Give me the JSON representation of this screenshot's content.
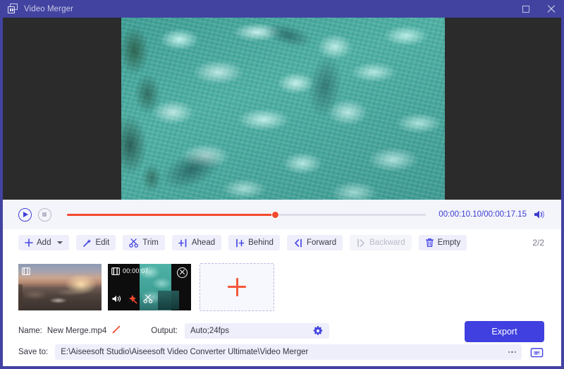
{
  "window": {
    "title": "Video Merger",
    "app_icon": "windows-stack-icon",
    "titlebar_color": "#4243a0",
    "controls": [
      {
        "name": "maximize-button",
        "icon": "maximize-icon"
      },
      {
        "name": "close-button",
        "icon": "close-icon"
      }
    ]
  },
  "preview": {
    "label": "video-preview",
    "letterbox_color": "#2b2b2b",
    "content_description": "turquoise water with caustic light patterns"
  },
  "player": {
    "play_icon": "play-icon",
    "stop_icon": "stop-icon",
    "progress_percent": 58,
    "progress_color": "#f4492d",
    "time_current": "00:00:10.10",
    "time_total": "00:00:17.15",
    "time_display": "00:00:10.10/00:00:17.15",
    "time_color": "#3b3bd0",
    "volume_icon": "volume-icon"
  },
  "toolbar": {
    "buttons": [
      {
        "label": "Add",
        "icon": "plus-icon",
        "has_dropdown": true,
        "disabled": false
      },
      {
        "label": "Edit",
        "icon": "magic-wand-icon",
        "has_dropdown": false,
        "disabled": false
      },
      {
        "label": "Trim",
        "icon": "scissors-icon",
        "has_dropdown": false,
        "disabled": false
      },
      {
        "label": "Ahead",
        "icon": "insert-ahead-icon",
        "has_dropdown": false,
        "disabled": false
      },
      {
        "label": "Behind",
        "icon": "insert-behind-icon",
        "has_dropdown": false,
        "disabled": false
      },
      {
        "label": "Forward",
        "icon": "move-forward-icon",
        "has_dropdown": false,
        "disabled": false
      },
      {
        "label": "Backward",
        "icon": "move-backward-icon",
        "has_dropdown": false,
        "disabled": true
      },
      {
        "label": "Empty",
        "icon": "trash-icon",
        "has_dropdown": false,
        "disabled": false
      }
    ],
    "counter": "2/2"
  },
  "clips": [
    {
      "name": "clip-1",
      "selected": false,
      "duration": "",
      "badge_icon": "film-icon",
      "thumbnail": "sunset-coastline"
    },
    {
      "name": "clip-2",
      "selected": true,
      "duration": "00:00:07",
      "badge_icon": "film-icon",
      "thumbnail": "turquoise-water",
      "close_icon": "close-circle-icon",
      "tools": [
        "volume-icon",
        "magic-wand-icon",
        "scissors-icon"
      ],
      "selection_color": "#f4492d"
    }
  ],
  "add_placeholder": {
    "icon": "plus-icon",
    "icon_color": "#f4593a"
  },
  "settings": {
    "name_label": "Name:",
    "name_value": "New Merge.mp4",
    "name_edit_icon": "pencil-icon",
    "output_label": "Output:",
    "output_value": "Auto;24fps",
    "output_gear_icon": "gear-icon",
    "save_label": "Save to:",
    "save_path": "E:\\Aiseesoft Studio\\Aiseesoft Video Converter Ultimate\\Video Merger",
    "browse_icon": "ellipsis-icon",
    "folder_icon": "folder-open-icon"
  },
  "export": {
    "label": "Export",
    "color": "#4040e0"
  }
}
